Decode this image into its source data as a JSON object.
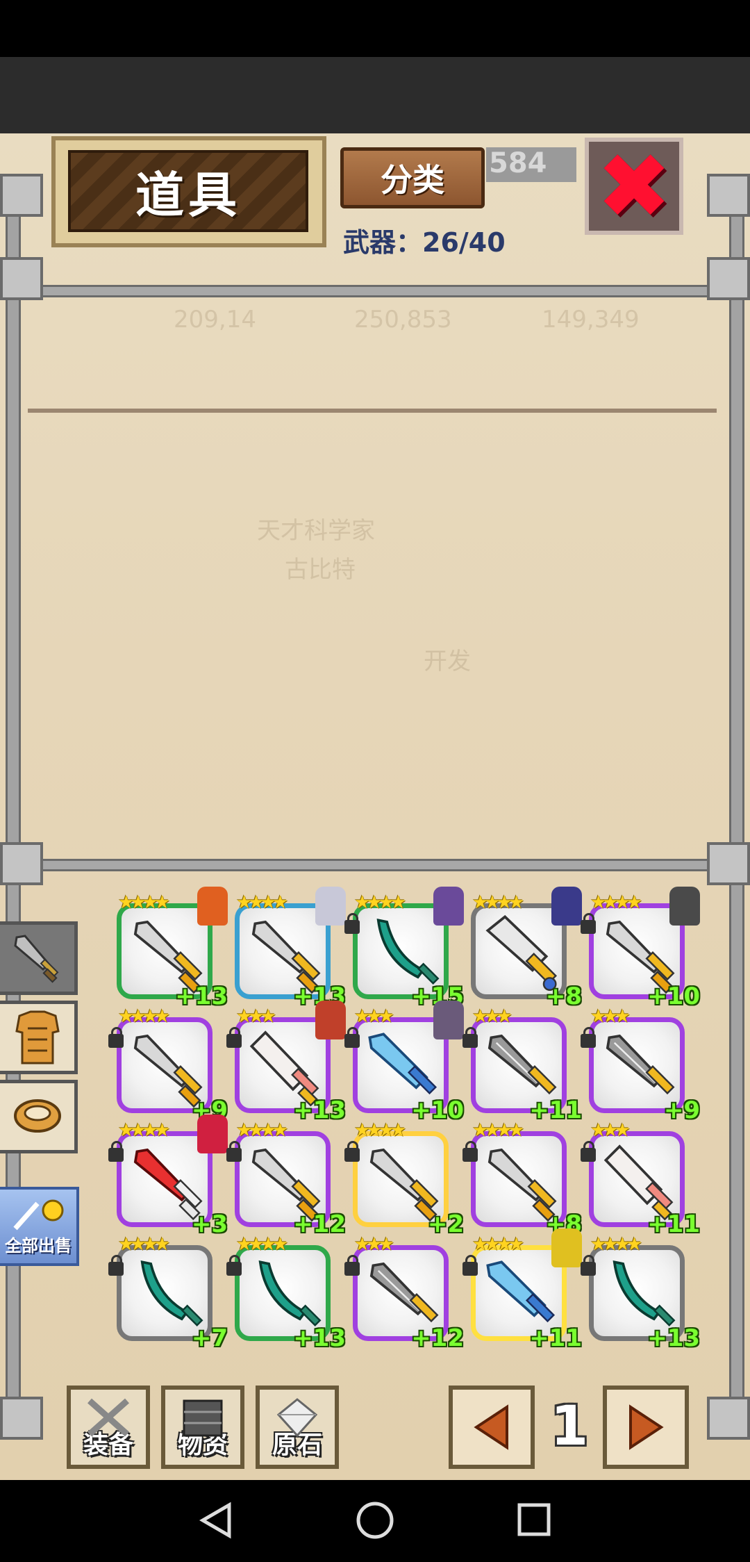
{
  "header": {
    "title": "道具",
    "classify_label": "分类",
    "weapon_count": "武器：26/40",
    "stat_partial": "584"
  },
  "faded_background": [
    "209,14",
    "250,853",
    "149,349",
    "天才科学家",
    "古比特",
    "开发"
  ],
  "side_tabs": [
    "weapon",
    "armor",
    "accessory"
  ],
  "sell_all_label": "全部出售",
  "items": [
    {
      "stars": "★★★★",
      "level": "+13",
      "frame": "#2fa84a",
      "locked": false,
      "chibi": "#e06020",
      "weapon": "sword-gold"
    },
    {
      "stars": "★★★★",
      "level": "+13",
      "frame": "#3aa0d0",
      "locked": false,
      "chibi": "#c8c8d8",
      "weapon": "sword-gold"
    },
    {
      "stars": "★★★★",
      "level": "+15",
      "frame": "#2fa84a",
      "locked": true,
      "chibi": "#6a4a9a",
      "weapon": "scimitar-green"
    },
    {
      "stars": "★★★★",
      "level": "+8",
      "frame": "#777777",
      "locked": false,
      "chibi": "#3a3a8a",
      "weapon": "sword-gold-wide"
    },
    {
      "stars": "★★★★",
      "level": "+10",
      "frame": "#a040e0",
      "locked": true,
      "chibi": "#4a4a4a",
      "weapon": "sword-gold"
    },
    {
      "stars": "★★★★",
      "level": "+9",
      "frame": "#a040e0",
      "locked": true,
      "chibi": null,
      "weapon": "sword-gold"
    },
    {
      "stars": "★★★",
      "level": "+13",
      "frame": "#a040e0",
      "locked": true,
      "chibi": "#c0402a",
      "weapon": "sword-pink"
    },
    {
      "stars": "★★★",
      "level": "+10",
      "frame": "#a040e0",
      "locked": true,
      "chibi": "#6a5a7a",
      "weapon": "sword-blue"
    },
    {
      "stars": "★★★",
      "level": "+11",
      "frame": "#a040e0",
      "locked": true,
      "chibi": null,
      "weapon": "sword-gray"
    },
    {
      "stars": "★★★",
      "level": "+9",
      "frame": "#a040e0",
      "locked": true,
      "chibi": null,
      "weapon": "sword-gray"
    },
    {
      "stars": "★★★★",
      "level": "+3",
      "frame": "#a040e0",
      "locked": true,
      "chibi": "#d02040",
      "weapon": "sword-red"
    },
    {
      "stars": "★★★★",
      "level": "+12",
      "frame": "#a040e0",
      "locked": true,
      "chibi": null,
      "weapon": "sword-gold"
    },
    {
      "stars": "★★★★",
      "level": "+2",
      "frame": "#ffd040",
      "locked": true,
      "chibi": null,
      "weapon": "sword-gold"
    },
    {
      "stars": "★★★★",
      "level": "+8",
      "frame": "#a040e0",
      "locked": true,
      "chibi": null,
      "weapon": "sword-gold"
    },
    {
      "stars": "★★★",
      "level": "+11",
      "frame": "#a040e0",
      "locked": true,
      "chibi": null,
      "weapon": "sword-pink"
    },
    {
      "stars": "★★★★",
      "level": "+7",
      "frame": "#777777",
      "locked": true,
      "chibi": null,
      "weapon": "scimitar-green"
    },
    {
      "stars": "★★★★",
      "level": "+13",
      "frame": "#2fa84a",
      "locked": true,
      "chibi": null,
      "weapon": "scimitar-green"
    },
    {
      "stars": "★★★",
      "level": "+12",
      "frame": "#a040e0",
      "locked": true,
      "chibi": null,
      "weapon": "sword-gray"
    },
    {
      "stars": "★★★★",
      "level": "+11",
      "frame": "#ffe040",
      "locked": true,
      "chibi": "#e0c020",
      "weapon": "sword-blue"
    },
    {
      "stars": "★★★★",
      "level": "+13",
      "frame": "#777777",
      "locked": true,
      "chibi": null,
      "weapon": "scimitar-green"
    }
  ],
  "bottom_nav": {
    "equip_label": "装备",
    "materials_label": "物资",
    "stone_label": "原石",
    "page": "1"
  },
  "colors": {
    "accent_green": "#7aff30",
    "close_red": "#ff1030"
  }
}
